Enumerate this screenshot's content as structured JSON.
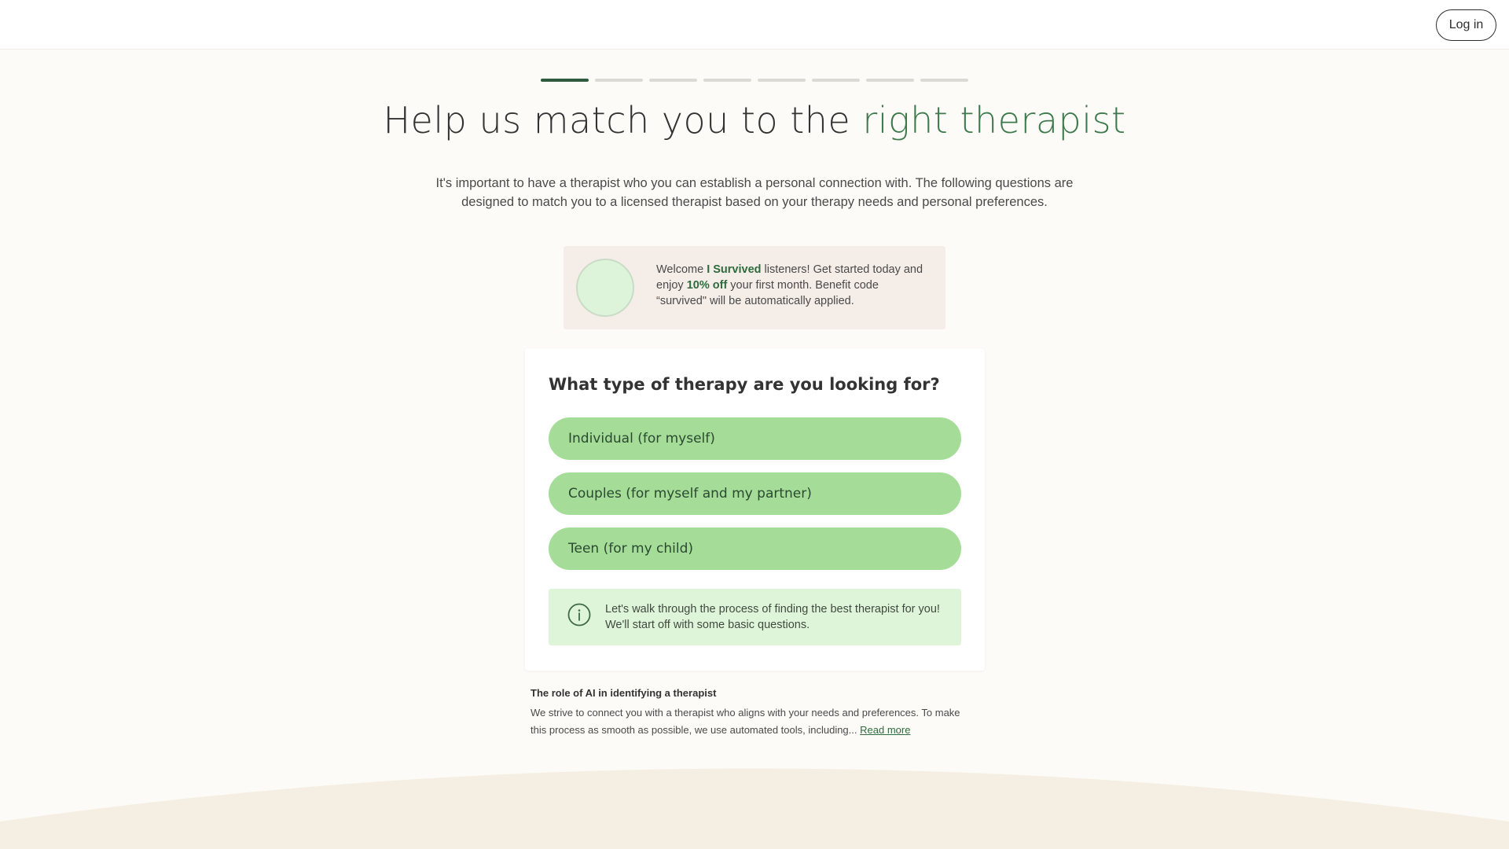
{
  "header": {
    "login_label": "Log in"
  },
  "progress": {
    "total_steps": 8,
    "current_step": 1
  },
  "headline": {
    "part1": "Help us match you to the ",
    "accent": "right therapist"
  },
  "intro": "It's important to have a therapist who you can establish a personal connection with. The following questions are designed to match you to a licensed therapist based on your therapy needs and personal preferences.",
  "promo": {
    "pre": "Welcome ",
    "podcast": "I Survived",
    "mid": " listeners! Get started today and enjoy ",
    "discount": "10% off",
    "post": " your first month. Benefit code “survived\" will be automatically applied."
  },
  "question_card": {
    "question": "What type of therapy are you looking for?",
    "options": [
      "Individual (for myself)",
      "Couples (for myself and my partner)",
      "Teen (for my child)"
    ],
    "info_text": "Let's walk through the process of finding the best therapist for you! We'll start off with some basic questions."
  },
  "ai_section": {
    "title": "The role of AI in identifying a therapist",
    "body": "We strive to connect you with a therapist who aligns with your needs and preferences. To make this process as smooth as possible, we use automated tools, including...",
    "read_more": "Read more"
  },
  "colors": {
    "page_bg": "#fdfbf7",
    "accent_green": "#3e7a4e",
    "option_green": "#a5dc98",
    "info_bg": "#dff5da",
    "promo_bg": "#f5ede8",
    "progress_active": "#2f5a3e",
    "progress_inactive": "#dcdad5",
    "wave": "#f5efe3"
  },
  "icons": {
    "info": "info-circle-icon"
  }
}
